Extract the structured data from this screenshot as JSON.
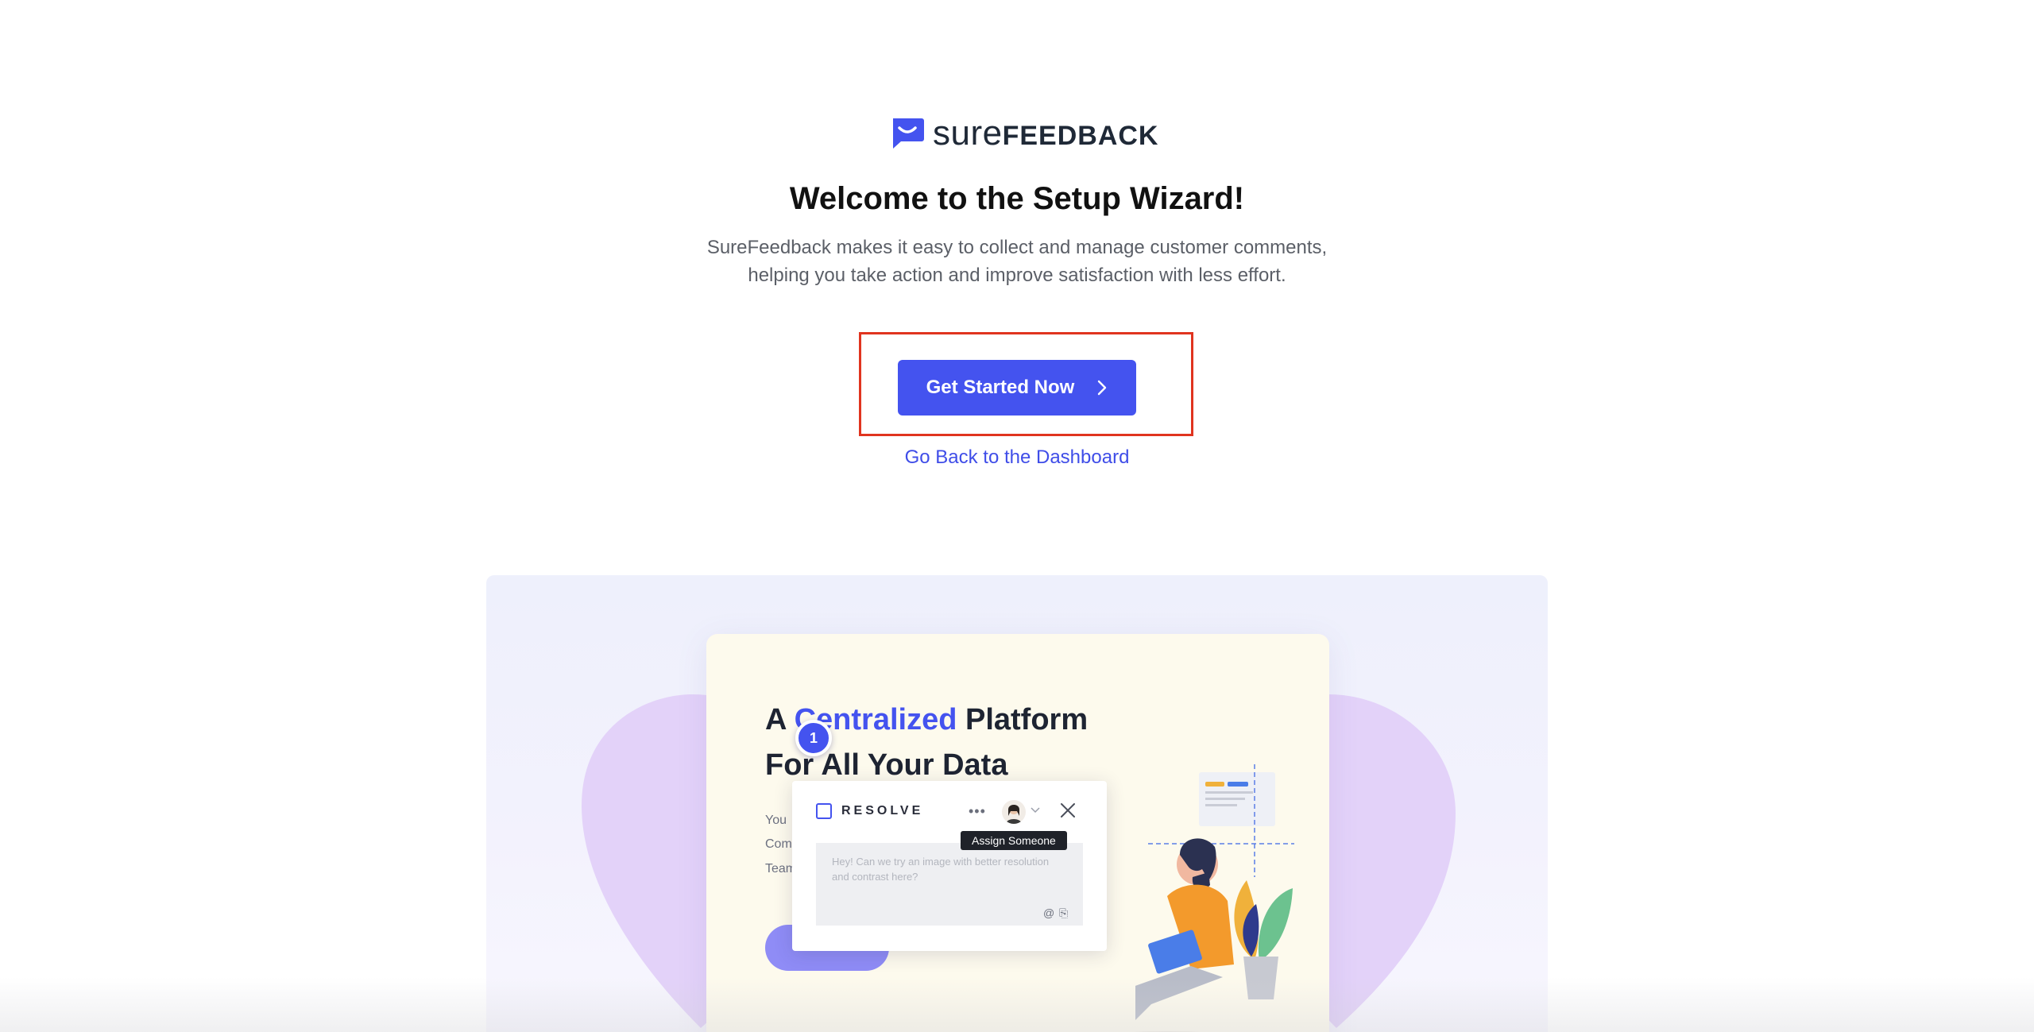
{
  "brand": {
    "name_light": "sure",
    "name_bold": "FEEDBACK",
    "color": "#4453ef"
  },
  "welcome": {
    "title": "Welcome to the Setup Wizard!",
    "description": "SureFeedback makes it easy to collect and manage customer comments, helping you take action and improve satisfaction with less effort."
  },
  "actions": {
    "primary_label": "Get Started Now",
    "primary_icon": "chevron-right-icon",
    "secondary_label": "Go Back to the Dashboard",
    "highlight_color": "#e0341f"
  },
  "hero": {
    "heading_pre": "A ",
    "heading_accent": "Centralized",
    "heading_post": " Platform",
    "heading_line2": "For All Your Data",
    "body_fragments": [
      "You",
      "Com",
      "Team"
    ],
    "comment": {
      "marker_number": "1",
      "resolve_label": "RESOLVE",
      "tooltip": "Assign Someone",
      "placeholder": "Hey! Can we try an image with better resolution and contrast here?",
      "icons": [
        "more-dots-icon",
        "avatar",
        "chevron-down-icon",
        "close-icon",
        "mention-icon",
        "attach-icon"
      ]
    }
  }
}
